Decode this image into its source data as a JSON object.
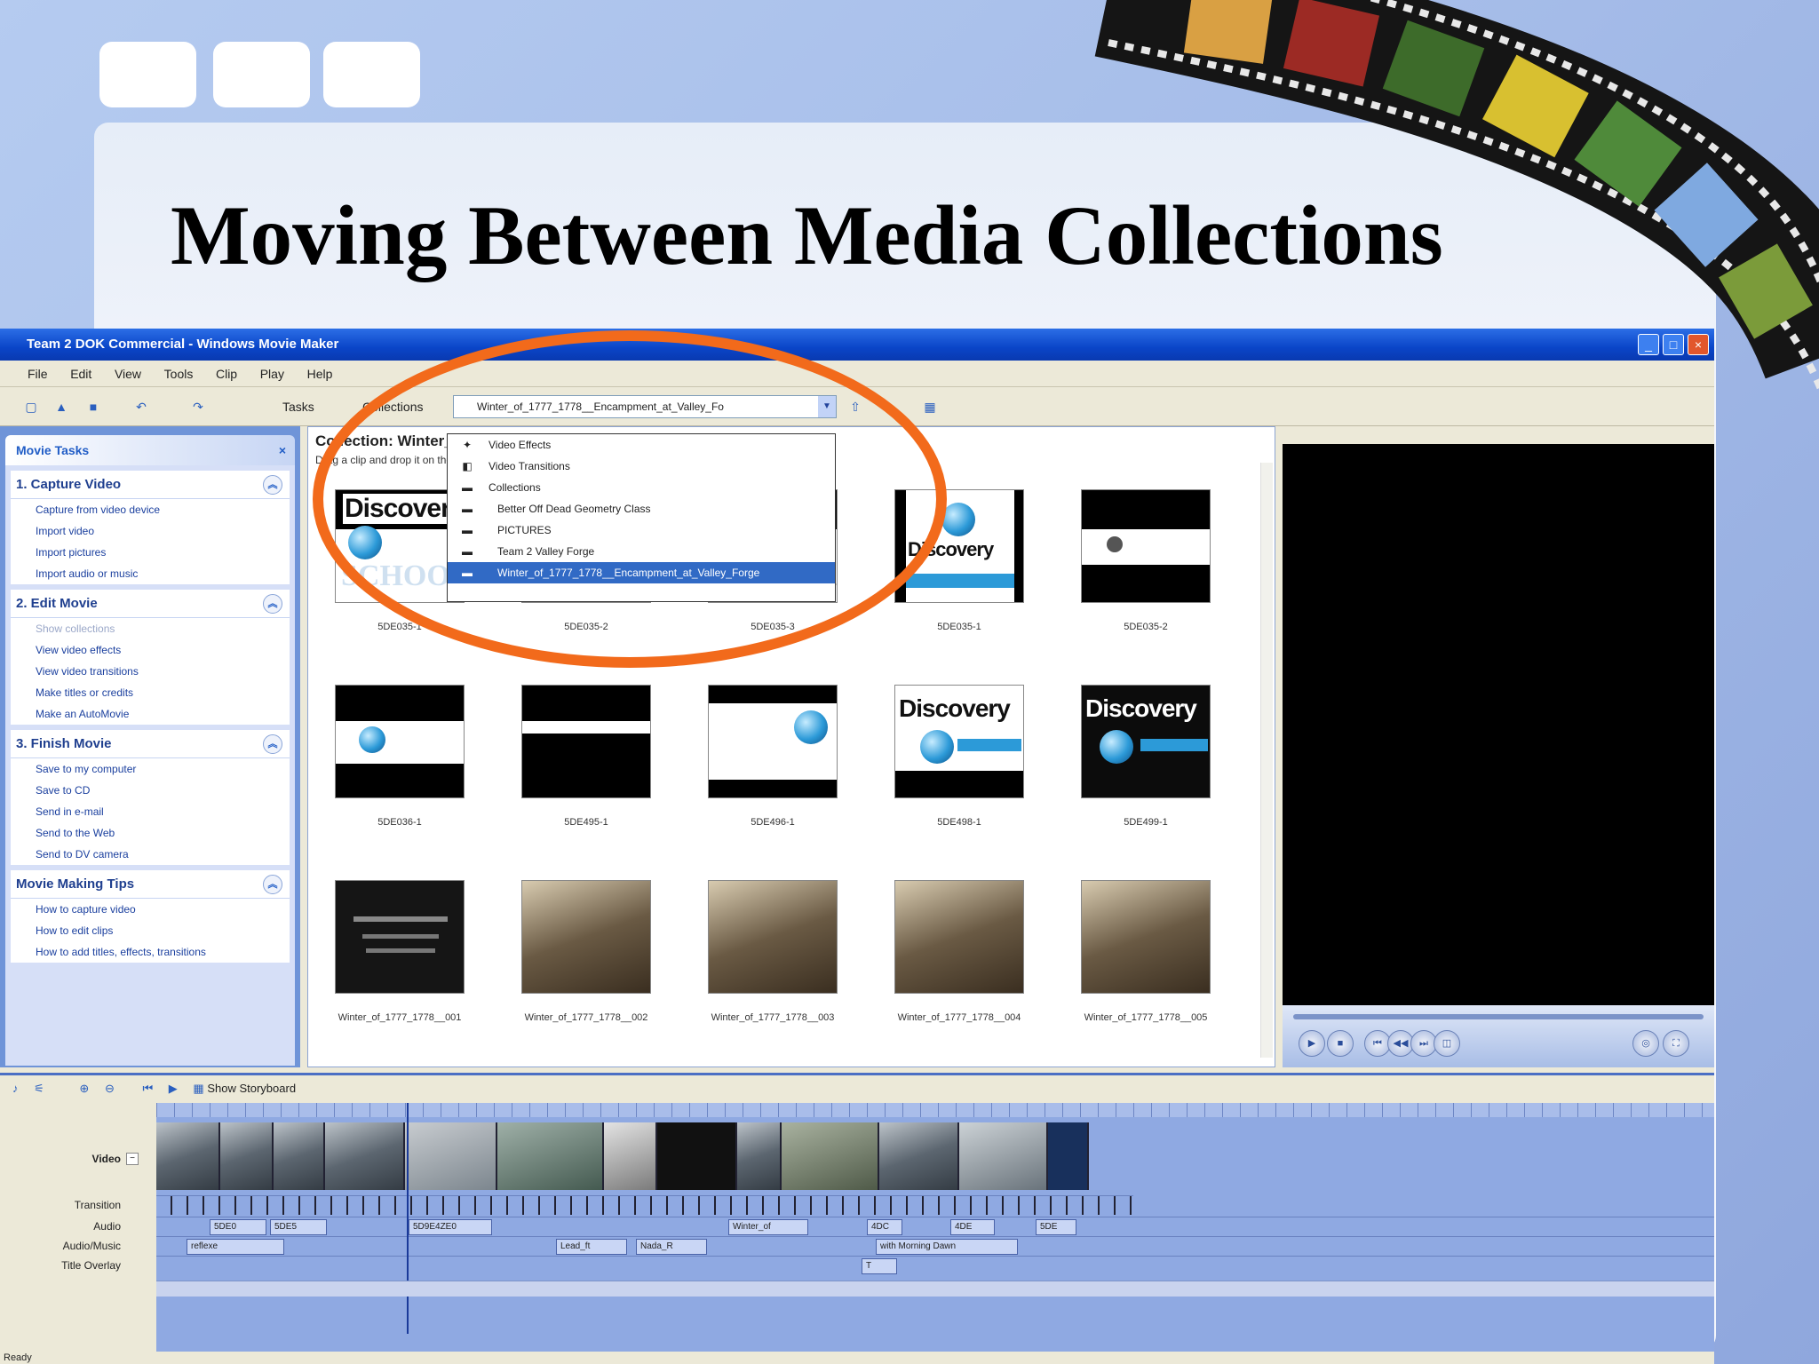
{
  "slide": {
    "title": "Moving Between Media Collections",
    "accent_color": "#f26a1b"
  },
  "window": {
    "title": "Team 2 DOK Commercial - Windows Movie Maker",
    "controls": [
      "_",
      "□",
      "×"
    ]
  },
  "menu": [
    "File",
    "Edit",
    "View",
    "Tools",
    "Clip",
    "Play",
    "Help"
  ],
  "toolbar": {
    "tasks_label": "Tasks",
    "collections_label": "Collections",
    "combo_value": "Winter_of_1777_1778__Encampment_at_Valley_Fo"
  },
  "dropdown": {
    "items": [
      {
        "label": "Video Effects",
        "icon": "effects-icon"
      },
      {
        "label": "Video Transitions",
        "icon": "transitions-icon"
      },
      {
        "label": "Collections",
        "icon": "folder-icon"
      },
      {
        "label": "Better Off Dead Geometry Class",
        "icon": "folder-icon"
      },
      {
        "label": "PICTURES",
        "icon": "folder-icon"
      },
      {
        "label": "Team 2 Valley Forge",
        "icon": "folder-icon"
      },
      {
        "label": "Winter_of_1777_1778__Encampment_at_Valley_Forge",
        "icon": "folder-icon"
      }
    ]
  },
  "tasks": {
    "header": "Movie Tasks",
    "sections": [
      {
        "title": "1. Capture Video",
        "items": [
          "Capture from video device",
          "Import video",
          "Import pictures",
          "Import audio or music"
        ]
      },
      {
        "title": "2. Edit Movie",
        "items": [
          "Show collections",
          "View video effects",
          "View video transitions",
          "Make titles or credits",
          "Make an AutoMovie"
        ]
      },
      {
        "title": "3. Finish Movie",
        "items": [
          "Save to my computer",
          "Save to CD",
          "Send in e-mail",
          "Send to the Web",
          "Send to DV camera"
        ]
      },
      {
        "title": "Movie Making Tips",
        "items": [
          "How to capture video",
          "How to edit clips",
          "How to add titles, effects, transitions"
        ]
      }
    ]
  },
  "collection": {
    "heading": "Collection: Winter_of_1777_1778__Encampment_at_Valley_Forge",
    "subheading": "Drag a clip and drop it on the storyboard below.",
    "thumbs": [
      {
        "caption": "5DE035-1",
        "style": "discovery-school"
      },
      {
        "caption": "5DE035-2",
        "style": "discovery-school"
      },
      {
        "caption": "5DE035-3",
        "style": "discovery-school"
      },
      {
        "caption": "5DE035-1",
        "style": "discovery-blue"
      },
      {
        "caption": "5DE035-2",
        "style": "black-bars"
      },
      {
        "caption": "5DE036-1",
        "style": "black-bars"
      },
      {
        "caption": "5DE495-1",
        "style": "black-bars"
      },
      {
        "caption": "5DE496-1",
        "style": "white-globe"
      },
      {
        "caption": "5DE498-1",
        "style": "discovery-blue"
      },
      {
        "caption": "5DE499-1",
        "style": "discovery-dark"
      },
      {
        "caption": "Winter_of_1777_1778__001",
        "style": "black-text"
      },
      {
        "caption": "Winter_of_1777_1778__002",
        "style": "sepia"
      },
      {
        "caption": "Winter_of_1777_1778__003",
        "style": "sepia"
      },
      {
        "caption": "Winter_of_1777_1778__004",
        "style": "sepia"
      },
      {
        "caption": "Winter_of_1777_1778__005",
        "style": "sepia"
      }
    ],
    "logo_text": "Discovery",
    "school_text": "SCHOOL"
  },
  "monitor": {
    "buttons": [
      "play-icon",
      "stop-icon",
      "previous-frame-icon",
      "next-frame-icon",
      "full-screen-icon"
    ]
  },
  "timeline": {
    "toolbar_label": "Show Storyboard",
    "track_labels": [
      "Video",
      "Transition",
      "Audio",
      "Audio/Music",
      "Title Overlay"
    ],
    "audio_clips": [
      "5DE0",
      "5DE5",
      "5D9E4ZE0",
      "Winter_of",
      "4DC",
      "4DE",
      "5DE"
    ],
    "music_clips": [
      "reflexe",
      "Lead_ft",
      "Nada_R",
      "with Morning Dawn"
    ],
    "title_clips": [
      "T"
    ]
  },
  "status": "Ready"
}
